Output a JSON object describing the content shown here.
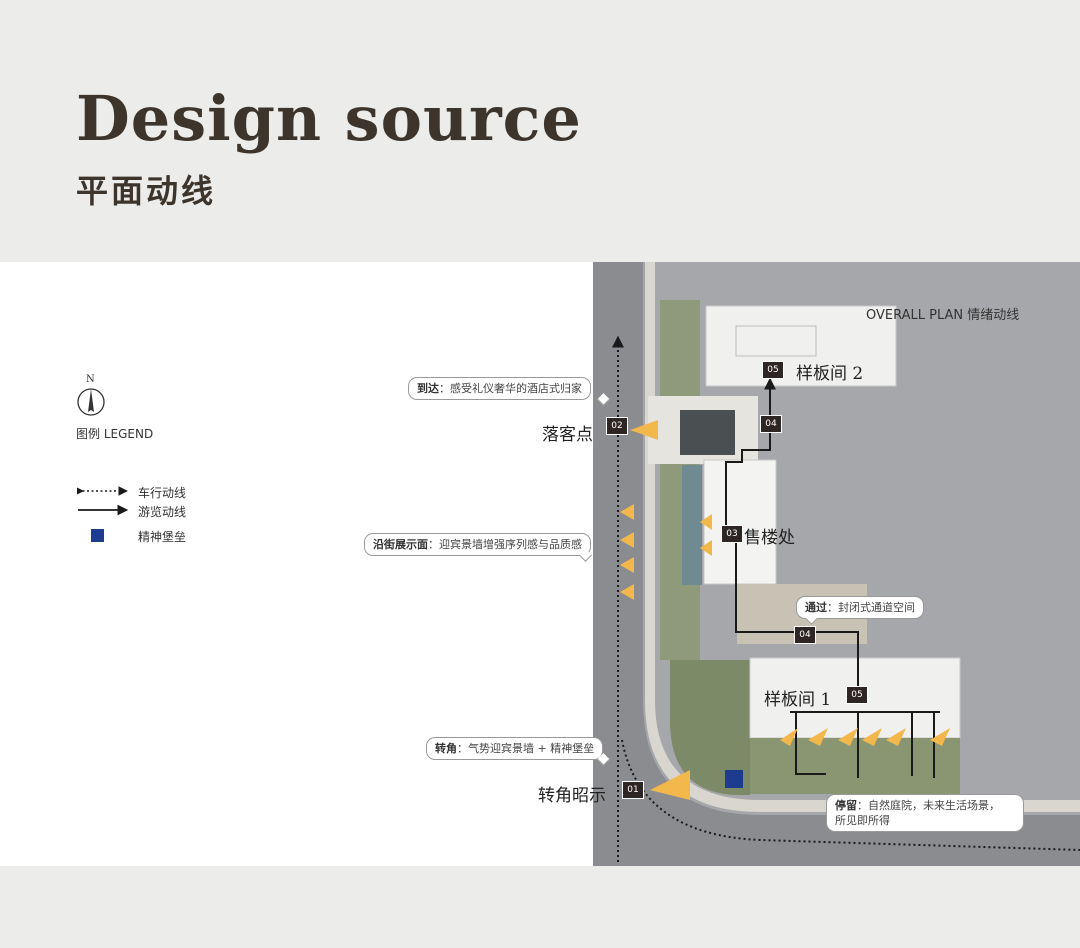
{
  "header": {
    "title": "Design source",
    "subtitle": "平面动线"
  },
  "plan": {
    "title": "OVERALL PLAN 情绪动线",
    "north": "N"
  },
  "legend": {
    "title": "图例 LEGEND",
    "items": [
      {
        "label": "车行动线",
        "icon": "dotted-double-arrow-icon"
      },
      {
        "label": "游览动线",
        "icon": "solid-arrow-icon"
      },
      {
        "label": "精神堡垒",
        "icon": "blue-square-icon",
        "color": "#1d3b8f"
      }
    ]
  },
  "places": {
    "sample_room_2": "样板间 2",
    "drop_off": "落客点",
    "sales_office": "售楼处",
    "sample_room_1": "样板间 1",
    "corner": "转角昭示"
  },
  "markers": {
    "m01": "01",
    "m02": "02",
    "m03": "03",
    "m04a": "04",
    "m04b": "04",
    "m05a": "05",
    "m05b": "05"
  },
  "callouts": {
    "arrive": {
      "key": "到达",
      "text": "：感受礼仪奢华的酒店式归家"
    },
    "street": {
      "key": "沿街展示面",
      "text": "：迎宾景墙增强序列感与品质感"
    },
    "pass": {
      "key": "通过",
      "text": "：封闭式通道空间"
    },
    "corner": {
      "key": "转角",
      "text": "：气势迎宾景墙 + 精神堡垒"
    },
    "stay": {
      "key": "停留",
      "text": "：自然庭院，未来生活场景，",
      "text2": "所见即所得"
    }
  },
  "colors": {
    "accent": "#f2b84b",
    "route": "#1a1a1a",
    "fortress": "#1d3b8f",
    "site_gray": "#a5a7aa",
    "road": "#7d7f82"
  }
}
